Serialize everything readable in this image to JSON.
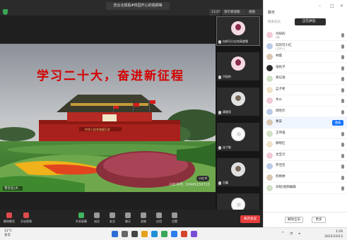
{
  "meeting": {
    "title": "曾云北观看#校园开心的视频等",
    "time": "13:07",
    "speaker_view_label": "演示者视图",
    "view_label": "视图",
    "slogan": "学习二十大，奋进新征程",
    "gate_text": "中华人民共和国万岁",
    "watermark": "小红书号: 10445150723",
    "presenter_name": "曾云北(大...",
    "badge": "小红书",
    "tiles": [
      {
        "name": "向的可小红的高就哦"
      },
      {
        "name": "丹阳的"
      },
      {
        "name": "康健亮"
      },
      {
        "name": "连丁能"
      },
      {
        "name": "吕鑫"
      },
      {
        "name": "彭朗"
      }
    ],
    "toolbar": {
      "mute": "解除静音",
      "video": "开启视频",
      "security": "安全",
      "share": "共享屏幕",
      "members": "成员",
      "chat": "聊天",
      "record": "录制",
      "apps": "应用",
      "settings": "设置",
      "end": "离开会议"
    }
  },
  "chat": {
    "title": "聊天",
    "search_placeholder": "搜索成员",
    "tab_label": "正在讲话：",
    "participants": [
      {
        "name": "丹阳的",
        "sub": "(我)"
      },
      {
        "name": "向的可小红",
        "sub": "(主持人)"
      },
      {
        "name": "林霞",
        "sub": ""
      },
      {
        "name": "张帆子",
        "sub": ""
      },
      {
        "name": "郑记涵",
        "sub": ""
      },
      {
        "name": "孟子希",
        "sub": ""
      },
      {
        "name": "木火",
        "sub": ""
      },
      {
        "name": "周晓元",
        "sub": ""
      },
      {
        "name": "惠安",
        "sub": ""
      },
      {
        "name": "王伟强",
        "sub": ""
      },
      {
        "name": "廖晓红",
        "sub": ""
      },
      {
        "name": "沈宝贝",
        "sub": ""
      },
      {
        "name": "罗佳佳",
        "sub": ""
      },
      {
        "name": "何婷婷",
        "sub": ""
      },
      {
        "name": "日程(视频编辑",
        "sub": ""
      }
    ],
    "invite_label": "邀请",
    "mute_all": "解除全员",
    "more": "更多"
  },
  "taskbar": {
    "temp": "12°C",
    "weather": "多云",
    "time": "1:29",
    "date": "2022/10/13"
  },
  "colors": {
    "slogan": "#d40000",
    "end_button": "#e63e3e",
    "invite": "#1976ff"
  }
}
